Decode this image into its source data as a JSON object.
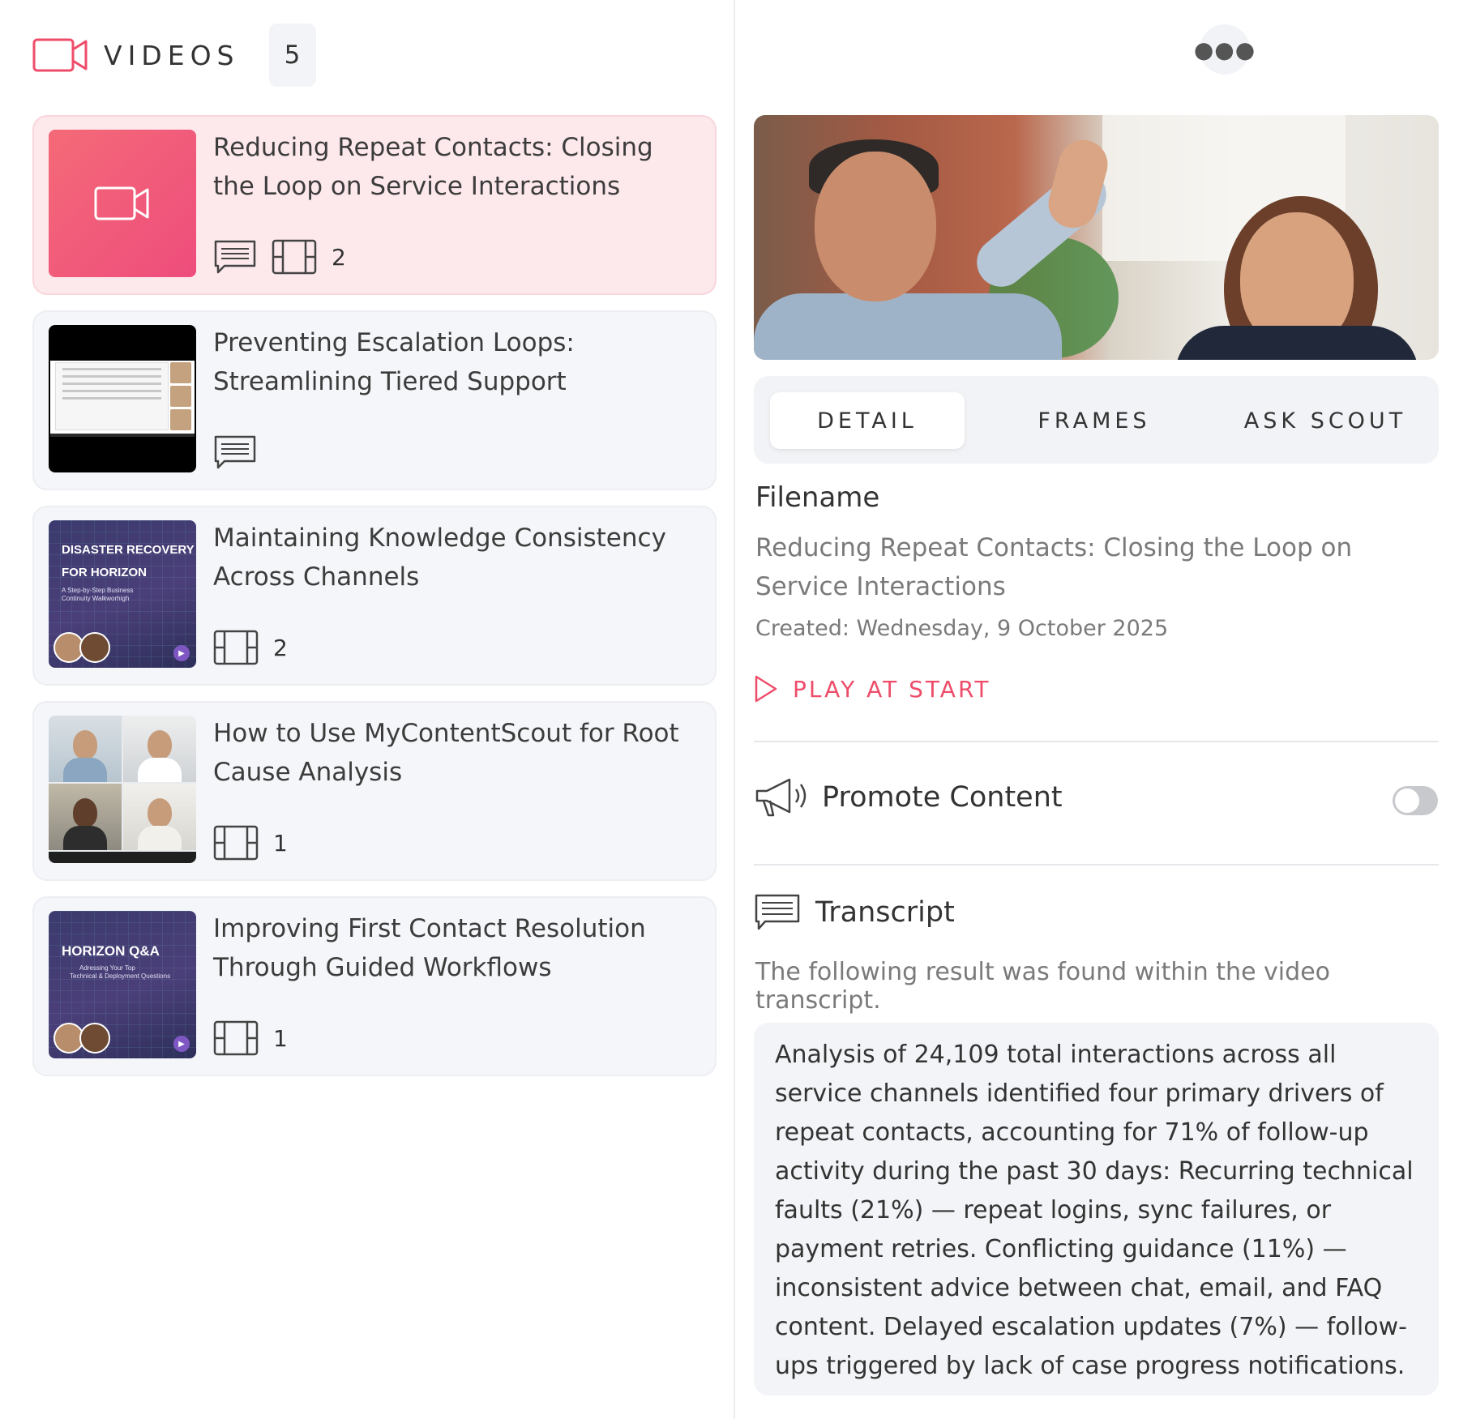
{
  "header": {
    "title": "VIDEOS",
    "count": "5",
    "icon": "video-camera-icon",
    "accent": "#ee4d6a"
  },
  "videos": [
    {
      "title": "Reducing Repeat Contacts: Closing the Loop on Service Interactions",
      "has_transcript": true,
      "has_frames": true,
      "frames": "2",
      "thumbnail": "placeholder-video-icon",
      "active": true
    },
    {
      "title": "Preventing Escalation Loops: Streamlining Tiered Support",
      "has_transcript": true,
      "has_frames": false,
      "frames": "",
      "thumbnail": "meeting-screen"
    },
    {
      "title": "Maintaining Knowledge Consistency Across Channels",
      "has_transcript": false,
      "has_frames": true,
      "frames": "2",
      "thumbnail": "disaster-recovery-card",
      "thumb_text": {
        "line1": "DISASTER RECOVERY",
        "line2": "FOR HORIZON",
        "line3": "A Step-by-Step Business",
        "line4": "Continuity Walkworhigh"
      }
    },
    {
      "title": "How to Use MyContentScout for Root Cause Analysis",
      "has_transcript": false,
      "has_frames": true,
      "frames": "1",
      "thumbnail": "video-call-grid"
    },
    {
      "title": "Improving First Contact Resolution Through Guided Workflows",
      "has_transcript": false,
      "has_frames": true,
      "frames": "1",
      "thumbnail": "horizon-qa-card",
      "thumb_text": {
        "line1": "HORIZON Q&A",
        "line2": "Adressing Your Top",
        "line3": "Technical & Deployment Questions"
      }
    }
  ],
  "detail": {
    "more_icon": "more-horizontal-icon",
    "tabs": [
      "DETAIL",
      "FRAMES",
      "ASK SCOUT"
    ],
    "active_tab": "DETAIL",
    "filename_label": "Filename",
    "filename": "Reducing Repeat Contacts: Closing the Loop on Service Interactions",
    "created": "Created: Wednesday, 9 October 2025",
    "play_label": "PLAY AT START",
    "promote_label": "Promote Content",
    "promote_enabled": false,
    "transcript_label": "Transcript",
    "transcript_sub": "The following result was found within the video transcript.",
    "transcript_text": "Analysis of 24,109 total interactions across all service channels identified four primary drivers of repeat contacts, accounting for 71% of follow-up activity during the past 30 days: Recurring technical faults (21%) — repeat logins, sync failures, or payment retries. Conflicting guidance (11%) — inconsistent advice between chat, email, and FAQ content. Delayed escalation updates (7%) — follow-ups triggered by lack of case progress notifications."
  }
}
